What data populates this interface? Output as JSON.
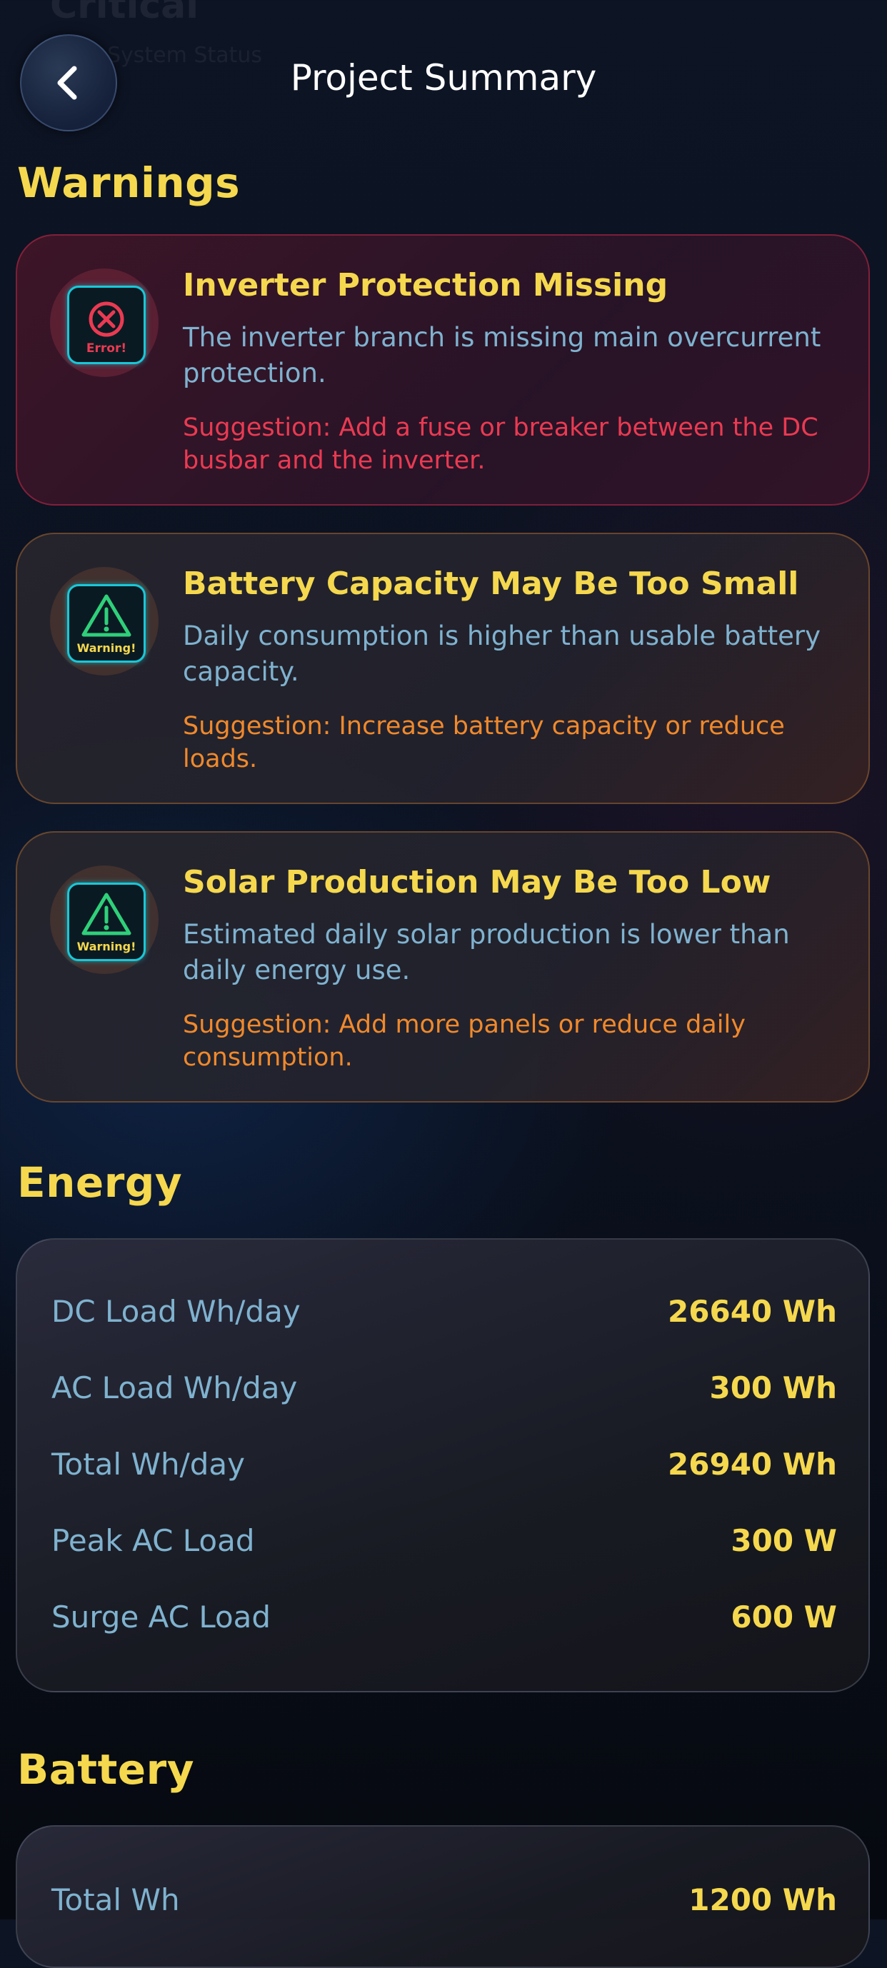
{
  "header": {
    "title": "Project Summary",
    "ghost_text": "Critical",
    "ghost_subtext": "System Status"
  },
  "warnings": {
    "heading": "Warnings",
    "items": [
      {
        "severity": "error",
        "icon": "error-icon",
        "badge": "Error!",
        "title": "Inverter Protection Missing",
        "description": "The inverter branch is missing main overcurrent protection.",
        "suggestion": "Suggestion: Add a fuse or breaker between the DC busbar and the inverter."
      },
      {
        "severity": "warning",
        "icon": "warning-icon",
        "badge": "Warning!",
        "title": "Battery Capacity May Be Too Small",
        "description": "Daily consumption is higher than usable battery capacity.",
        "suggestion": "Suggestion: Increase battery capacity or reduce loads."
      },
      {
        "severity": "warning",
        "icon": "warning-icon",
        "badge": "Warning!",
        "title": "Solar Production May Be Too Low",
        "description": "Estimated daily solar production is lower than daily energy use.",
        "suggestion": "Suggestion: Add more panels or reduce daily consumption."
      }
    ]
  },
  "energy": {
    "heading": "Energy",
    "rows": [
      {
        "label": "DC Load Wh/day",
        "value": "26640 Wh"
      },
      {
        "label": "AC Load Wh/day",
        "value": "300 Wh"
      },
      {
        "label": "Total Wh/day",
        "value": "26940 Wh"
      },
      {
        "label": "Peak AC Load",
        "value": "300 W"
      },
      {
        "label": "Surge AC Load",
        "value": "600 W"
      }
    ]
  },
  "battery": {
    "heading": "Battery",
    "rows": [
      {
        "label": "Total Wh",
        "value": "1200 Wh"
      }
    ]
  },
  "colors": {
    "accent_yellow": "#f5d84e",
    "label_blue": "#7fb2cf",
    "error_red": "#ea3a52",
    "warning_orange": "#f0892c",
    "icon_cyan": "#18c8d8"
  }
}
